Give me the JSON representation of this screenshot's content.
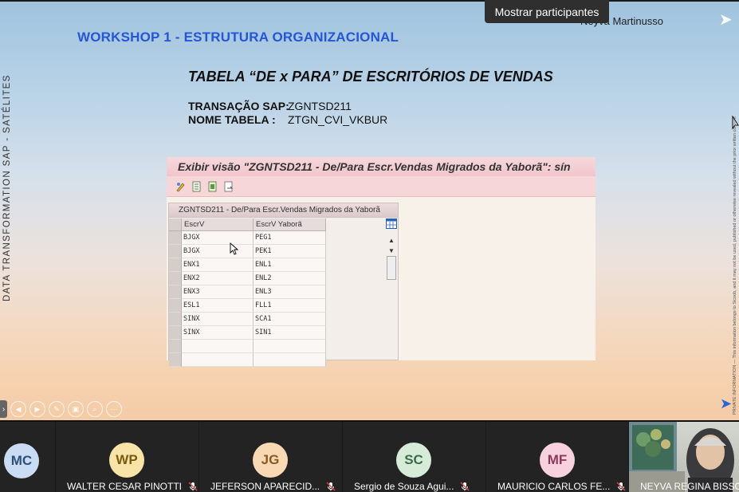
{
  "slide": {
    "workshop_title": "WORKSHOP 1  -  ESTRUTURA ORGANIZACIONAL",
    "presenter_label": "Neyva Martinusso",
    "tooltip": "Mostrar participantes",
    "side_label": "DATA  TRANSFORMATION   SAP  -   SATÉLITES",
    "fine_print": "PRIVATE INFORMATION — This information belongs to Sicoob, and it may not be used, published or otherwise revealed without the prior written consent",
    "subtitle": "TABELA “DE x PARA” DE  ESCRITÓRIOS DE VENDAS",
    "transacao_label": "TRANSAÇÃO SAP:",
    "transacao_value": "ZGNTSD211",
    "nome_tabela_label": "NOME TABELA     :",
    "nome_tabela_value": "ZTGN_CVI_VKBUR"
  },
  "sap": {
    "window_title": "Exibir visão \"ZGNTSD211 - De/Para Escr.Vendas Migrados da Yaborã\": sín",
    "grid_title": "ZGNTSD211 - De/Para Escr.Vendas Migrados da Yaborã",
    "columns": [
      "EscrV",
      "EscrV Yaborã"
    ],
    "rows": [
      [
        "BJGX",
        "PEG1"
      ],
      [
        "BJGX",
        "PEK1"
      ],
      [
        "ENX1",
        "ENL1"
      ],
      [
        "ENX2",
        "ENL2"
      ],
      [
        "ENX3",
        "ENL3"
      ],
      [
        "ESL1",
        "FLL1"
      ],
      [
        "SINX",
        "SCA1"
      ],
      [
        "SINX",
        "SIN1"
      ]
    ]
  },
  "participants": [
    {
      "initials": "MC",
      "name": "",
      "color": "#c9dcf3",
      "text_color": "#2d4f7c"
    },
    {
      "initials": "WP",
      "name": "WALTER CESAR PINOTTI",
      "color": "#f7e4a6",
      "text_color": "#7a5a12"
    },
    {
      "initials": "JG",
      "name": "JEFERSON APARECID...",
      "color": "#f9d9b4",
      "text_color": "#8a5a24"
    },
    {
      "initials": "SC",
      "name": "Sergio de Souza Agui...",
      "color": "#d6ecd9",
      "text_color": "#3f6a48"
    },
    {
      "initials": "MF",
      "name": "MAURICIO CARLOS FE...",
      "color": "#f7d1dd",
      "text_color": "#8c3a57"
    },
    {
      "initials": "",
      "name": "NEYVA REGINA BISSOL",
      "color": "",
      "text_color": ""
    }
  ]
}
